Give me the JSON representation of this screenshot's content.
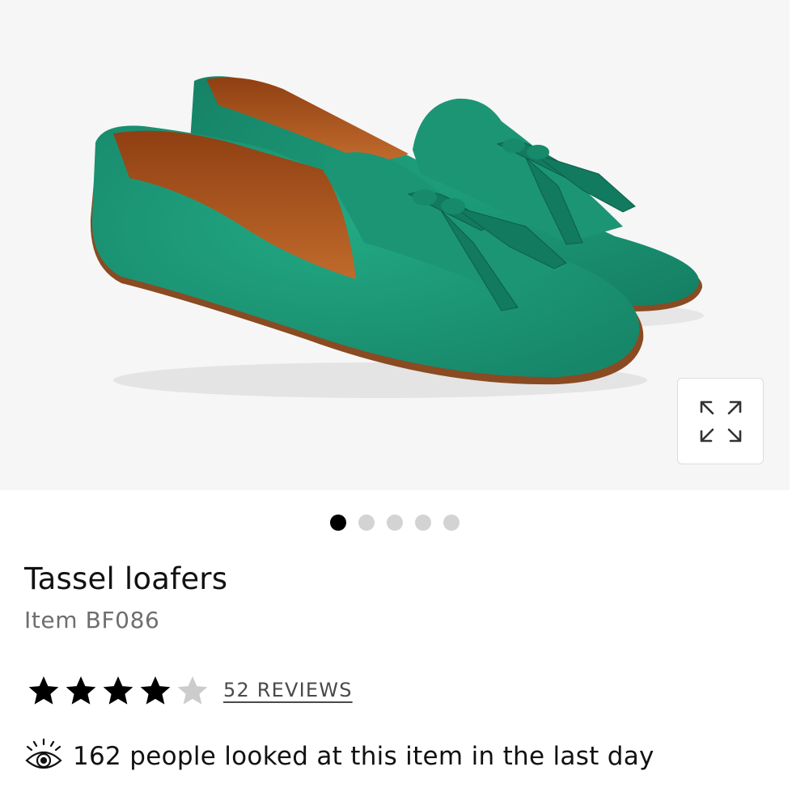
{
  "product": {
    "title": "Tassel loafers",
    "item_number": "Item BF086",
    "rating": {
      "value": 4,
      "max": 5,
      "reviews_label": "52 REVIEWS"
    },
    "social_proof": "162 people looked at this item in the last day"
  },
  "gallery": {
    "image_count": 5,
    "active_index": 0,
    "expand_icon": "expand-arrows-icon",
    "image_subject": "green suede tassel loafers",
    "colors": {
      "background": "#f6f6f6",
      "suede": "#1e9a78",
      "lining": "#a8531f",
      "sole": "#8a4a22"
    }
  },
  "colors": {
    "active_dot": "#000000",
    "inactive_dot": "#d3d3d3",
    "star_filled": "#000000",
    "star_empty": "#cccccc"
  }
}
